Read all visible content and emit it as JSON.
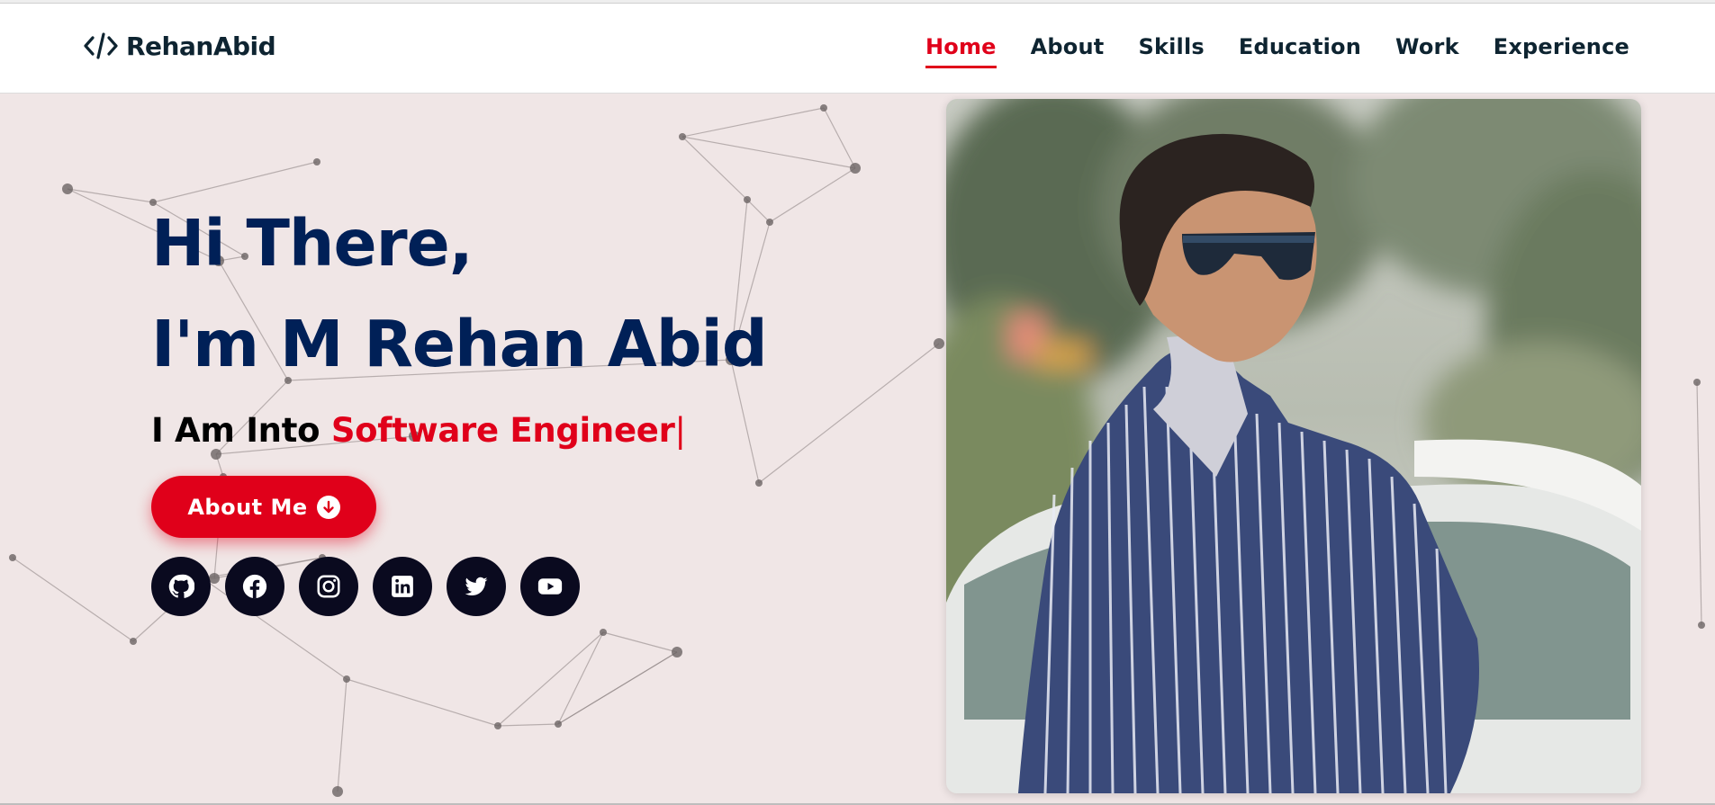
{
  "header": {
    "logo_text": "RehanAbid",
    "logo_icon": "code-icon",
    "nav": [
      {
        "label": "Home",
        "active": true
      },
      {
        "label": "About",
        "active": false
      },
      {
        "label": "Skills",
        "active": false
      },
      {
        "label": "Education",
        "active": false
      },
      {
        "label": "Work",
        "active": false
      },
      {
        "label": "Experience",
        "active": false
      }
    ]
  },
  "hero": {
    "greeting_line1": "Hi There,",
    "greeting_line2": "I'm M Rehan Abid",
    "typed_prefix": "I Am Into ",
    "typed_role": "Software Engineer",
    "typed_caret": "|",
    "about_button": "About Me",
    "about_button_icon": "arrow-down-circle-icon",
    "socials": [
      "github-icon",
      "facebook-icon",
      "instagram-icon",
      "linkedin-icon",
      "twitter-icon",
      "youtube-icon"
    ],
    "profile_photo_alt": "portrait-photo"
  },
  "colors": {
    "accent": "#e0001a",
    "heading": "#002057",
    "background": "#f0e6e6",
    "text_dark": "#0e2431",
    "social_bg": "#0a0a1f"
  }
}
